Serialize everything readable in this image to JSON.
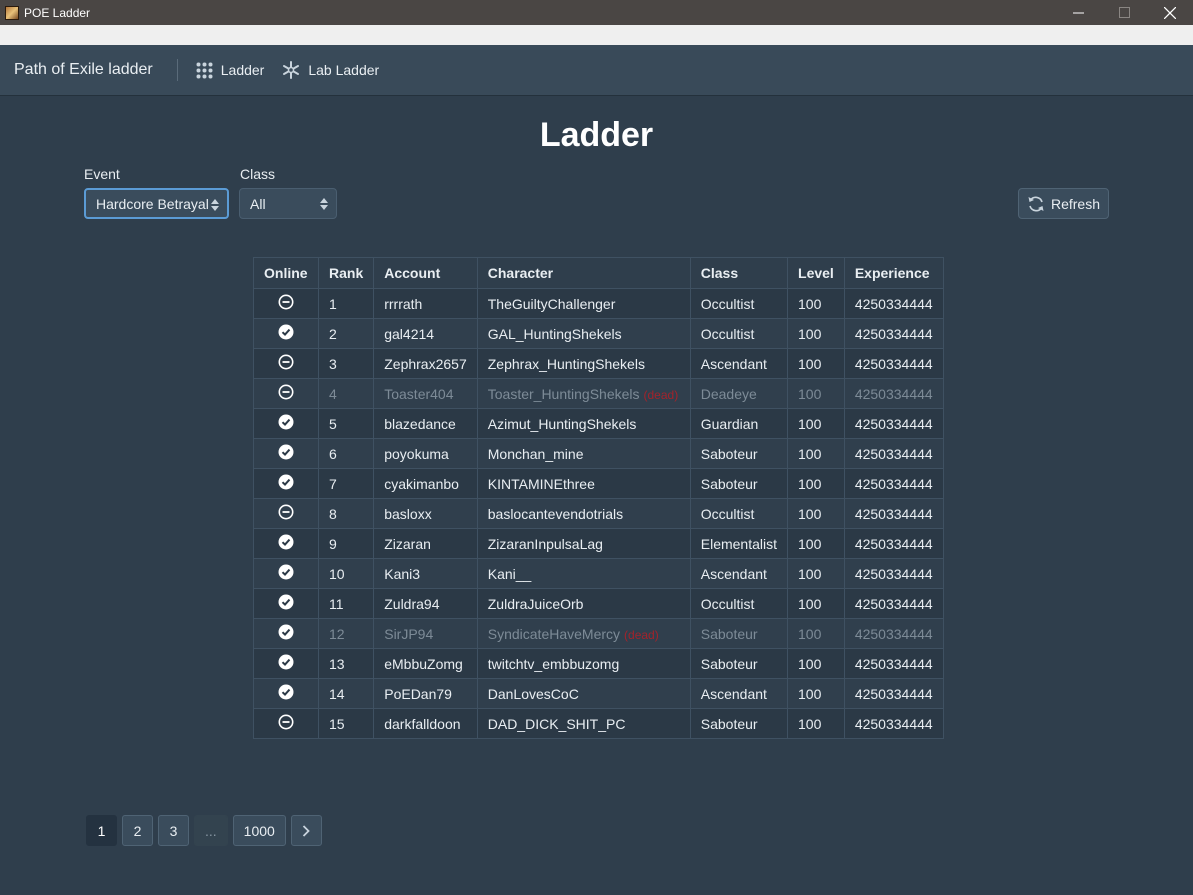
{
  "window": {
    "title": "POE Ladder",
    "minimize": "—",
    "maximize": "☐",
    "close": "✕"
  },
  "navbar": {
    "brand": "Path of Exile ladder",
    "items": [
      {
        "label": "Ladder",
        "icon": "grid-icon"
      },
      {
        "label": "Lab Ladder",
        "icon": "snowflake-icon"
      }
    ]
  },
  "page": {
    "title": "Ladder",
    "event_label": "Event",
    "event_value": "Hardcore Betrayal",
    "class_label": "Class",
    "class_value": "All",
    "refresh_label": "Refresh"
  },
  "table": {
    "headers": [
      "Online",
      "Rank",
      "Account",
      "Character",
      "Class",
      "Level",
      "Experience"
    ],
    "dead_label": "(dead)",
    "rows": [
      {
        "online": false,
        "rank": "1",
        "account": "rrrrath",
        "character": "TheGuiltyChallenger",
        "class": "Occultist",
        "level": "100",
        "experience": "4250334444",
        "dead": false
      },
      {
        "online": true,
        "rank": "2",
        "account": "gal4214",
        "character": "GAL_HuntingShekels",
        "class": "Occultist",
        "level": "100",
        "experience": "4250334444",
        "dead": false
      },
      {
        "online": false,
        "rank": "3",
        "account": "Zephrax2657",
        "character": "Zephrax_HuntingShekels",
        "class": "Ascendant",
        "level": "100",
        "experience": "4250334444",
        "dead": false
      },
      {
        "online": false,
        "rank": "4",
        "account": "Toaster404",
        "character": "Toaster_HuntingShekels",
        "class": "Deadeye",
        "level": "100",
        "experience": "4250334444",
        "dead": true
      },
      {
        "online": true,
        "rank": "5",
        "account": "blazedance",
        "character": "Azimut_HuntingShekels",
        "class": "Guardian",
        "level": "100",
        "experience": "4250334444",
        "dead": false
      },
      {
        "online": true,
        "rank": "6",
        "account": "poyokuma",
        "character": "Monchan_mine",
        "class": "Saboteur",
        "level": "100",
        "experience": "4250334444",
        "dead": false
      },
      {
        "online": true,
        "rank": "7",
        "account": "cyakimanbo",
        "character": "KINTAMINEthree",
        "class": "Saboteur",
        "level": "100",
        "experience": "4250334444",
        "dead": false
      },
      {
        "online": false,
        "rank": "8",
        "account": "basloxx",
        "character": "baslocantevendotrials",
        "class": "Occultist",
        "level": "100",
        "experience": "4250334444",
        "dead": false
      },
      {
        "online": true,
        "rank": "9",
        "account": "Zizaran",
        "character": "ZizaranInpulsaLag",
        "class": "Elementalist",
        "level": "100",
        "experience": "4250334444",
        "dead": false
      },
      {
        "online": true,
        "rank": "10",
        "account": "Kani3",
        "character": "Kani__",
        "class": "Ascendant",
        "level": "100",
        "experience": "4250334444",
        "dead": false
      },
      {
        "online": true,
        "rank": "11",
        "account": "Zuldra94",
        "character": "ZuldraJuiceOrb",
        "class": "Occultist",
        "level": "100",
        "experience": "4250334444",
        "dead": false
      },
      {
        "online": true,
        "rank": "12",
        "account": "SirJP94",
        "character": "SyndicateHaveMercy",
        "class": "Saboteur",
        "level": "100",
        "experience": "4250334444",
        "dead": true
      },
      {
        "online": true,
        "rank": "13",
        "account": "eMbbuZomg",
        "character": "twitchtv_embbuzomg",
        "class": "Saboteur",
        "level": "100",
        "experience": "4250334444",
        "dead": false
      },
      {
        "online": true,
        "rank": "14",
        "account": "PoEDan79",
        "character": "DanLovesCoC",
        "class": "Ascendant",
        "level": "100",
        "experience": "4250334444",
        "dead": false
      },
      {
        "online": false,
        "rank": "15",
        "account": "darkfalldoon",
        "character": "DAD_DICK_SHIT_PC",
        "class": "Saboteur",
        "level": "100",
        "experience": "4250334444",
        "dead": false
      }
    ]
  },
  "pagination": {
    "pages": [
      "1",
      "2",
      "3",
      "...",
      "1000"
    ],
    "active": "1",
    "next": "›"
  },
  "colors": {
    "background": "#2f3e4c",
    "navbar": "#394a59",
    "dead_text": "#a3232b",
    "focus_border": "#5b9bd5"
  }
}
